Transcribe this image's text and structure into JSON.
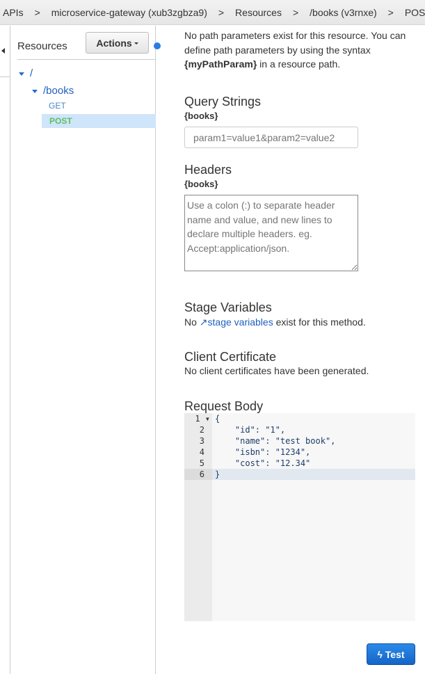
{
  "breadcrumb": [
    "APIs",
    "microservice-gateway (xub3zgbza9)",
    "Resources",
    "/books (v3rnxe)",
    "POST"
  ],
  "breadcrumb_sep": ">",
  "sidebar": {
    "title": "Resources",
    "actions_label": "Actions",
    "tree": {
      "root": "/",
      "books": "/books",
      "get": "GET",
      "post": "POST"
    }
  },
  "main": {
    "path_params_1": "No path parameters exist for this resource. You can define path parameters by using the syntax ",
    "path_params_bold": "{myPathParam}",
    "path_params_2": " in a resource path.",
    "query_title": "Query Strings",
    "query_sub": "{books}",
    "query_placeholder": "param1=value1&param2=value2",
    "headers_title": "Headers",
    "headers_sub": "{books}",
    "headers_placeholder": "Use a colon (:) to separate header name and value, and new lines to declare multiple headers. eg. Accept:application/json.",
    "stage_title": "Stage Variables",
    "stage_pre": "No ",
    "stage_link": "stage variables",
    "stage_post": " exist for this method.",
    "cert_title": "Client Certificate",
    "cert_text": "No client certificates have been generated.",
    "body_title": "Request Body",
    "body_lines": [
      "{",
      "    \"id\": \"1\",",
      "    \"name\": \"test book\",",
      "    \"isbn\": \"1234\",",
      "    \"cost\": \"12.34\"",
      "}"
    ],
    "test_label": "Test"
  },
  "colors": {
    "accent": "#1f6ed4",
    "post": "#5fbf5f",
    "selected": "#cfe5fa"
  }
}
